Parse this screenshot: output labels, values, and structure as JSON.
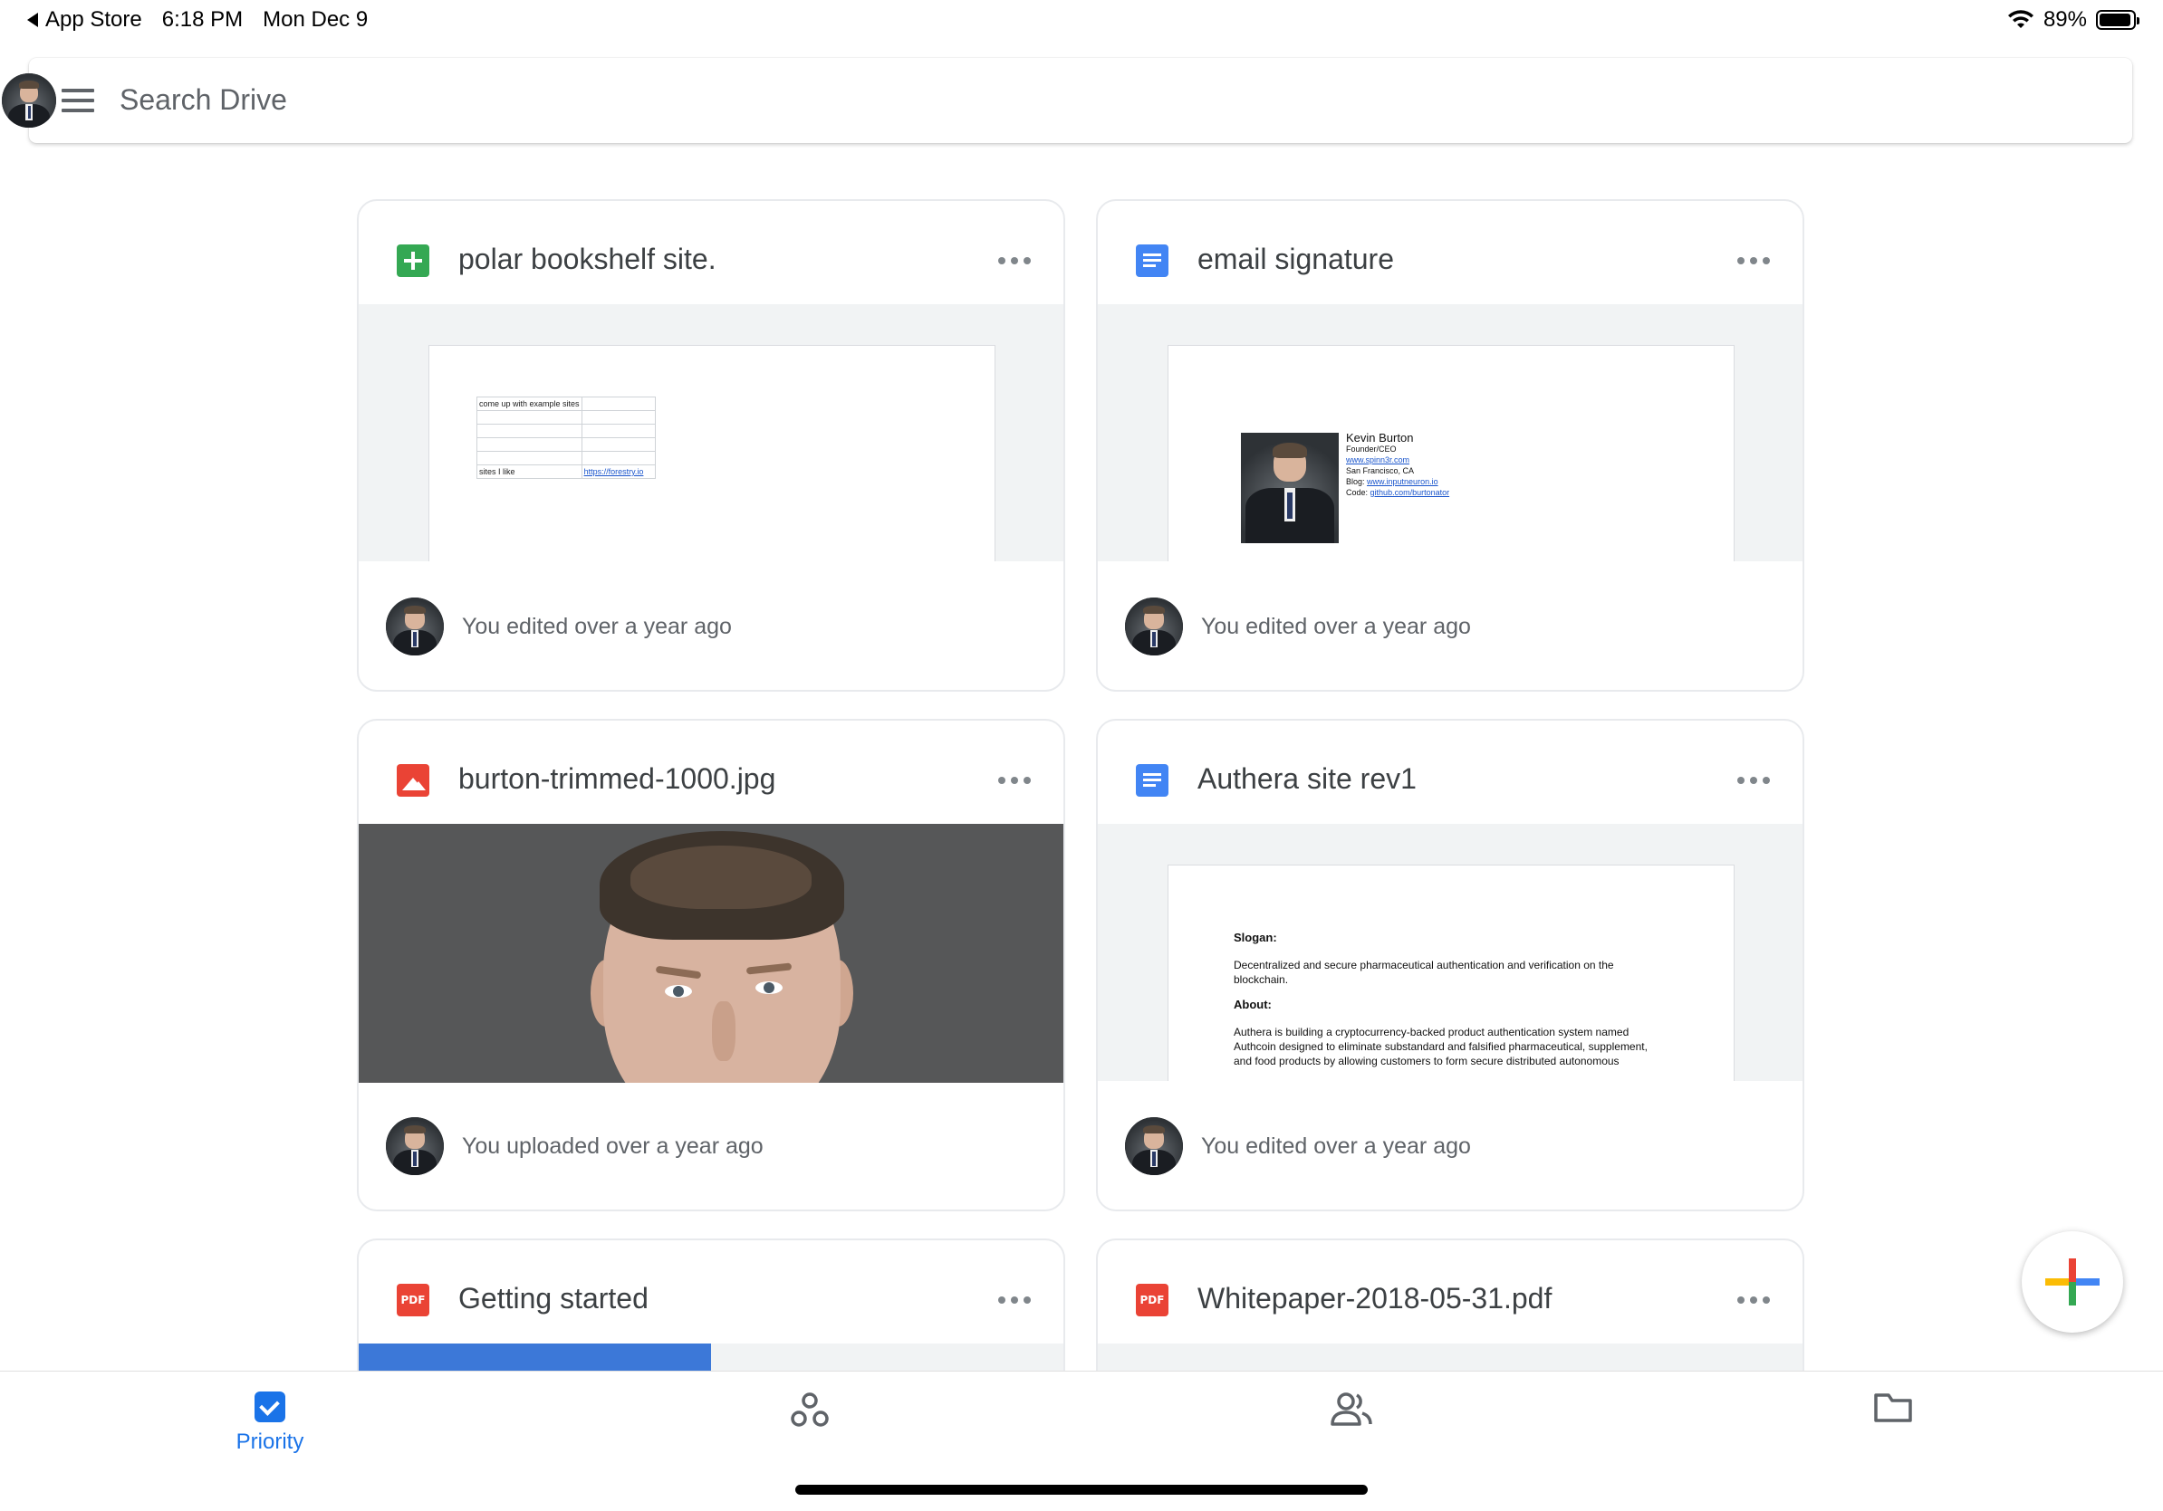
{
  "status_bar": {
    "back_app": "App Store",
    "time": "6:18 PM",
    "date": "Mon Dec 9",
    "battery": "89%"
  },
  "search": {
    "placeholder": "Search Drive"
  },
  "cards": [
    {
      "title": "polar bookshelf site.",
      "file_type": "sheets",
      "activity": "You edited over a year ago",
      "preview": {
        "rows": [
          [
            "come up with example sites",
            ""
          ],
          [
            "",
            ""
          ],
          [
            "",
            ""
          ],
          [
            "",
            ""
          ],
          [
            "",
            ""
          ],
          [
            "sites I like",
            "https://forestry.io"
          ]
        ]
      }
    },
    {
      "title": "email signature",
      "file_type": "docs",
      "activity": "You edited over a year ago",
      "preview": {
        "name": "Kevin Burton",
        "role": "Founder/CEO",
        "site": "www.spinn3r.com",
        "location": "San Francisco, CA",
        "blog_label": "Blog:",
        "blog": "www.inputneuron.io",
        "code_label": "Code:",
        "code": "github.com/burtonator"
      }
    },
    {
      "title": "burton-trimmed-1000.jpg",
      "file_type": "image",
      "activity": "You uploaded over a year ago"
    },
    {
      "title": "Authera site rev1",
      "file_type": "docs",
      "activity": "You edited over a year ago",
      "preview": {
        "slogan_heading": "Slogan:",
        "slogan": "Decentralized and secure pharmaceutical authentication and verification on the blockchain.",
        "about_heading": "About:",
        "about": "Authera is building a cryptocurrency-backed product authentication system named Authcoin designed to eliminate substandard and falsified pharmaceutical, supplement, and food products by allowing customers to form secure distributed autonomous"
      }
    },
    {
      "title": "Getting started",
      "file_type": "pdf",
      "preview_progress": 0.5
    },
    {
      "title": "Whitepaper-2018-05-31.pdf",
      "file_type": "pdf"
    }
  ],
  "pdf_badge": "PDF",
  "bottom_nav": {
    "items": [
      {
        "label": "Priority",
        "icon": "checkbox-icon",
        "active": true
      },
      {
        "label": "",
        "icon": "workspaces-icon"
      },
      {
        "label": "",
        "icon": "shared-people-icon"
      },
      {
        "label": "",
        "icon": "folder-icon"
      }
    ]
  },
  "fab": {
    "icon": "new-plus-icon"
  },
  "colors": {
    "accent": "#1a73e8",
    "sheets": "#34a853",
    "docs": "#4285f4",
    "image": "#ea4335",
    "pdf": "#ea4335"
  }
}
